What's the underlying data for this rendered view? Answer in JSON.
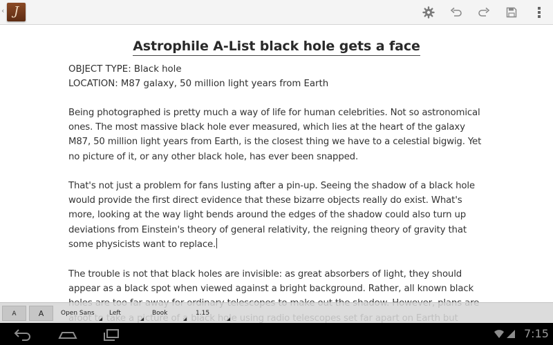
{
  "action_bar": {
    "back_glyph": "‹",
    "app_icon_letter": "J",
    "icons": [
      "settings-icon",
      "undo-icon",
      "redo-icon",
      "save-icon",
      "overflow-menu-icon"
    ]
  },
  "document": {
    "title": "Astrophile A-List black hole gets a face",
    "object_type": "OBJECT TYPE: Black hole",
    "location": "LOCATION: M87 galaxy, 50 million light years from Earth",
    "paragraph_1": "Being photographed is pretty much a way of life for human celebrities. Not so astronomical ones. The most massive black hole ever measured, which lies at the heart of the galaxy M87, 50 million light years from Earth, is the closest thing we have to a celestial bigwig. Yet no picture of it, or any other black hole, has ever been snapped.",
    "paragraph_2": "That's not just a problem for fans lusting after a pin-up. Seeing the shadow of a black hole would provide the first direct evidence that these bizarre objects really do exist. What's more, looking at the way light bends around the edges of the shadow could also turn up deviations from Einstein's theory of general relativity, the reigning theory of gravity that some physicists want to replace.",
    "paragraph_3": "The trouble is not that black holes are invisible: as great absorbers of light, they should appear as a black spot when viewed against a bright background. Rather, all known black holes are too far away for ordinary telescopes to make out the shadow. However, plans are afoot to take a picture of a black hole using radio telescopes set far apart on Earth but which"
  },
  "format_toolbar": {
    "font_size_small": "A",
    "font_size_large": "A",
    "font_family": "Open Sans",
    "alignment": "Left",
    "font_style": "Book",
    "line_spacing": "1.15"
  },
  "system_bar": {
    "clock": "7:15",
    "icons": [
      "back-icon",
      "home-icon",
      "recent-apps-icon",
      "wifi-icon",
      "signal-icon"
    ]
  },
  "colors": {
    "app_icon": "#6e3518",
    "text": "#333333",
    "toolbar": "#d6d6d6",
    "system_bar": "#000000"
  }
}
